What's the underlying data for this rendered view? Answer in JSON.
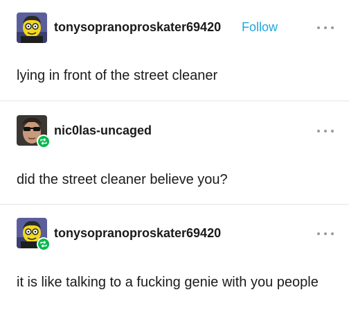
{
  "posts": [
    {
      "username": "tonysopranoproskater69420",
      "follow_label": "Follow",
      "text": "lying in front of the street cleaner",
      "avatar": "cartoon-character-avatar",
      "reblog_badge": false
    },
    {
      "username": "nic0las-uncaged",
      "text": "did the street cleaner believe you?",
      "avatar": "sunglasses-man-avatar",
      "reblog_badge": true
    },
    {
      "username": "tonysopranoproskater69420",
      "text": "it is like talking to a fucking genie with you people",
      "avatar": "cartoon-character-avatar",
      "reblog_badge": true
    }
  ],
  "colors": {
    "accent": "#1fa6e0",
    "reblog": "#00b94a",
    "divider": "#e4e4e4",
    "text": "#1a1a1a"
  },
  "icons": {
    "more": "more-options-icon",
    "reblog": "reblog-icon"
  }
}
